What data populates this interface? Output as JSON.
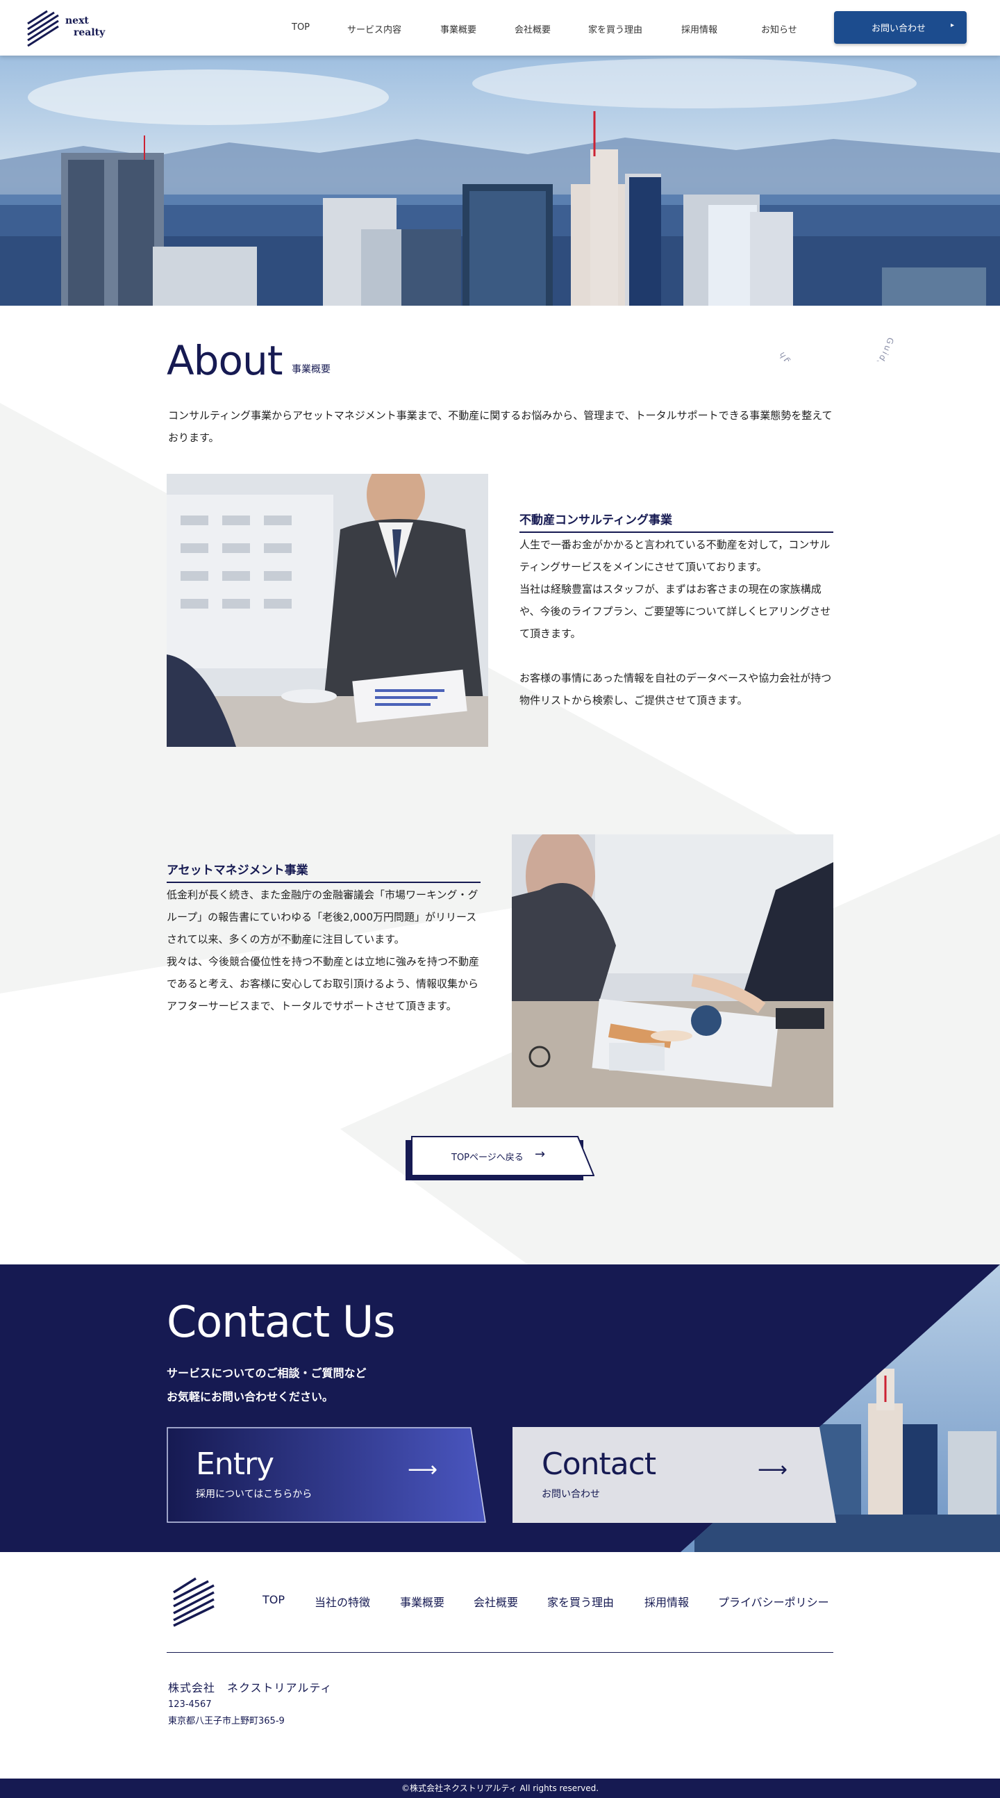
{
  "header": {
    "logo_line1": "next",
    "logo_line2": "realty",
    "nav": [
      "TOP",
      "サービス内容",
      "事業概要",
      "会社概要",
      "家を買う理由",
      "採用情報",
      "お知らせ"
    ],
    "inquiry_button": "お問い合わせ",
    "inquiry_arrow": "▸"
  },
  "hero": {
    "rotating_text": "Guide your asset through"
  },
  "about": {
    "title": "About",
    "subtitle": "事業概要",
    "lead": "コンサルティング事業からアセットマネジメント事業まで、不動産に関するお悩みから、管理まで、トータルサポートできる事業態勢を整えております。",
    "sections": [
      {
        "heading": "不動産コンサルティング事業",
        "paragraphs": [
          "人生で一番お金がかかると言われている不動産を対して，コンサルティングサービスをメインにさせて頂いております。",
          "当社は経験豊富はスタッフが、まずはお客さまの現在の家族構成や、今後のライフプラン、ご要望等について詳しくヒアリングさせて頂きます。",
          "お客様の事情にあった情報を自社のデータベースや協力会社が持つ物件リストから検索し、ご提供させて頂きます。"
        ]
      },
      {
        "heading": "アセットマネジメント事業",
        "paragraphs": [
          "低金利が長く続き、また金融庁の金融審議会「市場ワーキング・グループ」の報告書にていわゆる「老後2,000万円問題」がリリースされて以来、多くの方が不動産に注目しています。",
          "我々は、今後競合優位性を持つ不動産とは立地に強みを持つ不動産であると考え、お客様に安心してお取引頂けるよう、情報収集からアフターサービスまで、トータルでサポートさせて頂きます。"
        ]
      }
    ],
    "back_button": "TOPページへ戻る",
    "back_arrow": "→"
  },
  "contact": {
    "title": "Contact Us",
    "lead_line1": "サービスについてのご相談・ご質問など",
    "lead_line2": "お気軽にお問い合わせください。",
    "entry": {
      "title": "Entry",
      "sub": "採用についてはこちらから",
      "arrow": "⟶"
    },
    "contact_card": {
      "title": "Contact",
      "sub": "お問い合わせ",
      "arrow": "⟶"
    }
  },
  "footer": {
    "nav": [
      "TOP",
      "当社の特徴",
      "事業概要",
      "会社概要",
      "家を買う理由",
      "採用情報",
      "プライバシーポリシー"
    ],
    "company": "株式会社　ネクストリアルティ",
    "zip": "123-4567",
    "address": "東京都八王子市上野町365-9",
    "copyright": "©株式会社ネクストリアルティ All rights reserved."
  },
  "colors": {
    "navy": "#161a52",
    "button_blue": "#1c4c8e",
    "entry_gradient_end": "#4a56c0",
    "contact_card_bg": "#dfe0e6"
  }
}
